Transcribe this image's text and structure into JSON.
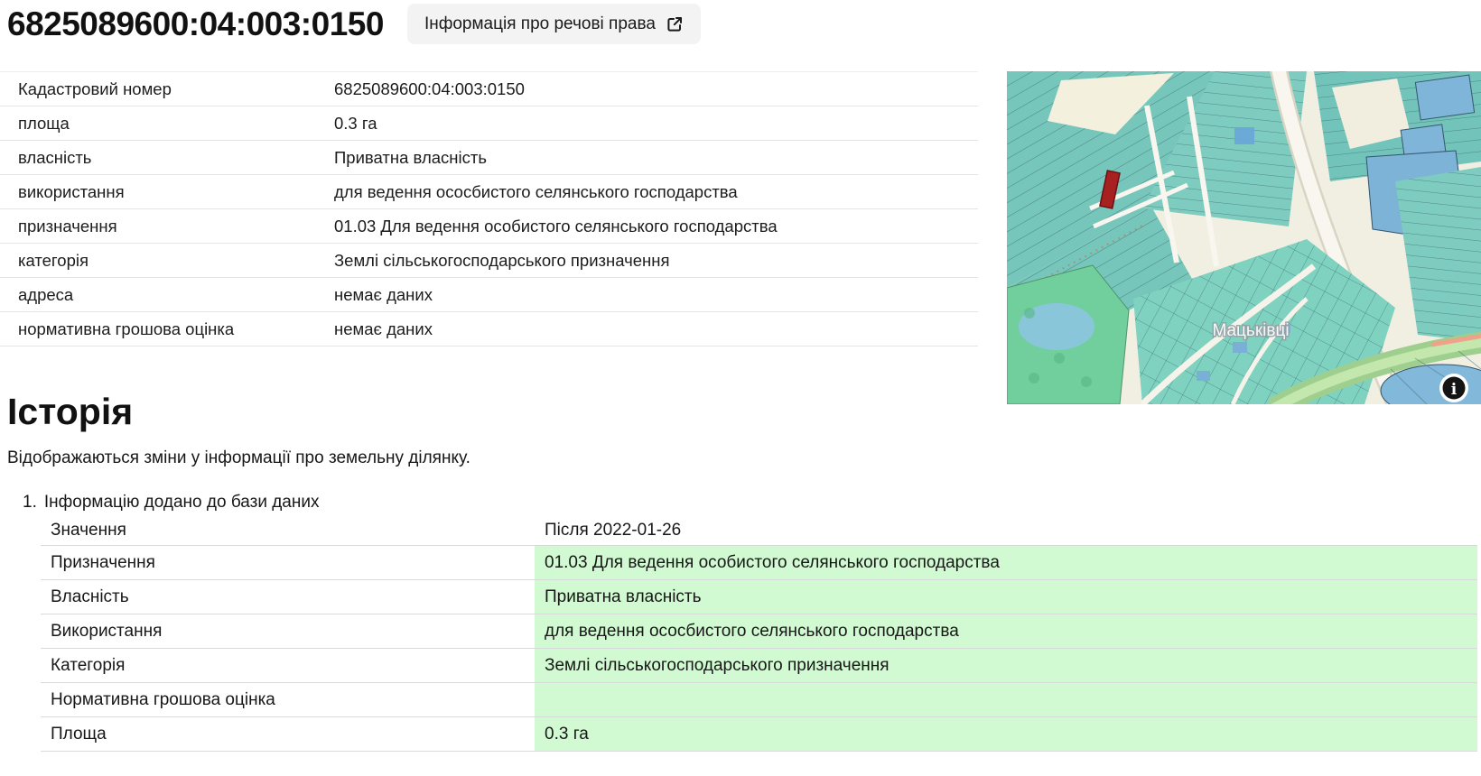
{
  "page": {
    "title": "6825089600:04:003:0150",
    "rights_button_label": "Інформація про речові права"
  },
  "icons": {
    "external_link": "↗",
    "map_info": "i"
  },
  "colors": {
    "added_green": "#d2fad2",
    "highlight_parcel_red": "#a6211f",
    "button_bg": "#f3f3f4",
    "map_teal": "#76c6bb",
    "map_blue": "#7cb3d7",
    "map_forest_green": "#70cf9d",
    "map_background_cream": "#f1efe1"
  },
  "parcel_info": {
    "rows": [
      {
        "label": "Кадастровий номер",
        "value": "6825089600:04:003:0150"
      },
      {
        "label": "площа",
        "value": "0.3 га"
      },
      {
        "label": "власність",
        "value": "Приватна власність"
      },
      {
        "label": "використання",
        "value": "для ведення ососбистого селянського господарства"
      },
      {
        "label": "призначення",
        "value": "01.03 Для ведення особистого селянського господарства"
      },
      {
        "label": "категорія",
        "value": "Землі сільськогосподарського призначення"
      },
      {
        "label": "адреса",
        "value": "немає даних"
      },
      {
        "label": "нормативна грошова оцінка",
        "value": "немає даних"
      }
    ]
  },
  "map": {
    "place_label": "Мацьківці"
  },
  "history": {
    "heading": "Історія",
    "description": "Відображаються зміни у інформації про земельну ділянку.",
    "entries": [
      {
        "number": "1.",
        "title": "Інформацію додано до бази даних",
        "value_header": "Значення",
        "date_header": "Після 2022-01-26",
        "rows": [
          {
            "label": "Призначення",
            "value": "01.03 Для ведення особистого селянського господарства"
          },
          {
            "label": "Власність",
            "value": "Приватна власність"
          },
          {
            "label": "Використання",
            "value": "для ведення ососбистого селянського господарства"
          },
          {
            "label": "Категорія",
            "value": "Землі сільськогосподарського призначення"
          },
          {
            "label": "Нормативна грошова оцінка",
            "value": ""
          },
          {
            "label": "Площа",
            "value": "0.3 га"
          }
        ]
      }
    ]
  }
}
